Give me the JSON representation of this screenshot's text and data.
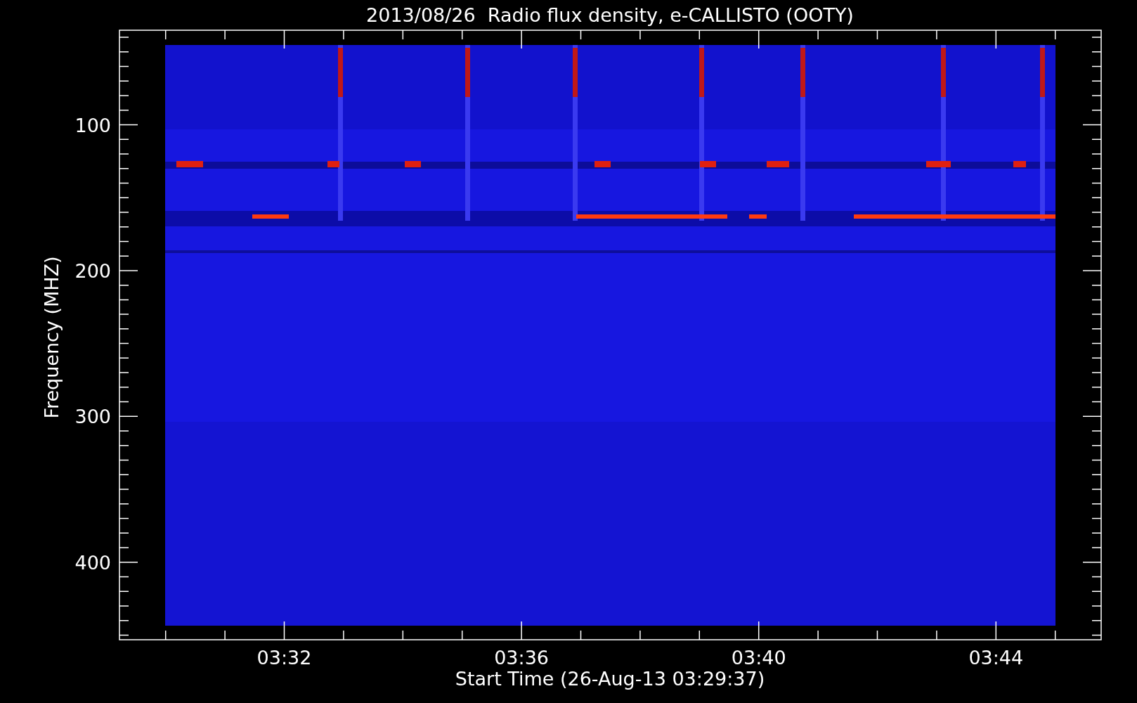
{
  "plot": {
    "title": "2013/08/26  Radio flux density, e-CALLISTO (OOTY)",
    "ylabel": "Frequency (MHZ)",
    "xlabel": "Start Time (26-Aug-13 03:29:37)",
    "y_tick_labels": [
      "100",
      "200",
      "300",
      "400"
    ],
    "x_tick_labels": [
      "03:32",
      "03:36",
      "03:40",
      "03:44"
    ]
  }
}
